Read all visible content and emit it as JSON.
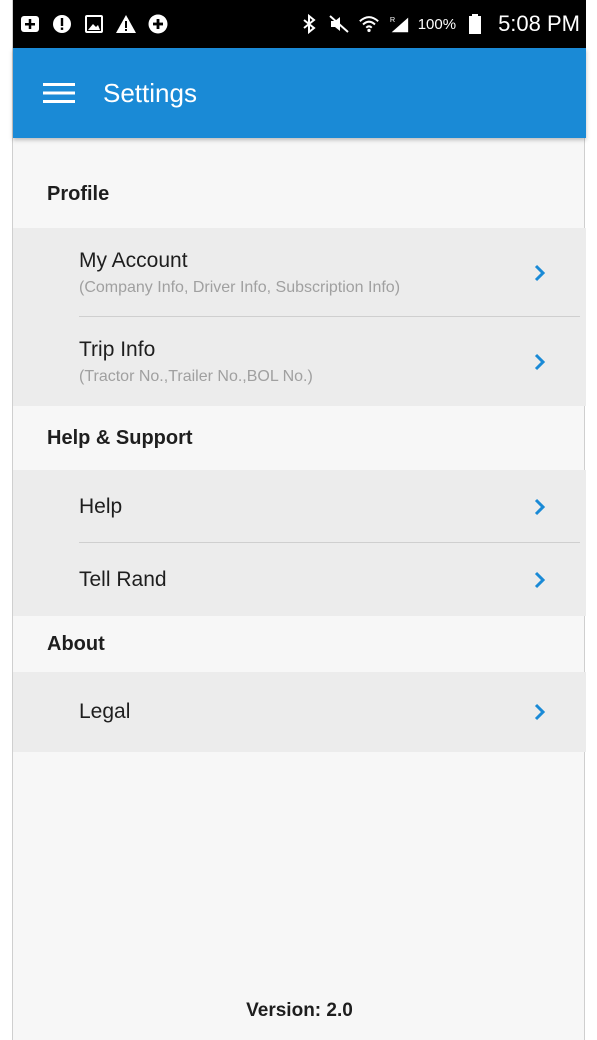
{
  "status_bar": {
    "battery_percent": "100%",
    "time": "5:08 PM",
    "icons": [
      "add-box-icon",
      "alert-circle-icon",
      "image-icon",
      "warning-icon",
      "plus-circle-icon",
      "bluetooth-icon",
      "mute-icon",
      "wifi-icon",
      "signal-roaming-icon",
      "battery-icon"
    ]
  },
  "app_bar": {
    "title": "Settings",
    "background": "#1a8ad6",
    "menu_icon": "hamburger-menu-icon"
  },
  "sections": [
    {
      "header": "Profile",
      "items": [
        {
          "title": "My Account",
          "subtitle": "(Company Info, Driver Info, Subscription Info)"
        },
        {
          "title": "Trip Info",
          "subtitle": "(Tractor No.,Trailer No.,BOL No.)"
        }
      ]
    },
    {
      "header": "Help & Support",
      "items": [
        {
          "title": "Help"
        },
        {
          "title": "Tell Rand"
        }
      ]
    },
    {
      "header": "About",
      "items": [
        {
          "title": "Legal"
        }
      ]
    }
  ],
  "accent_color": "#1a8ad6",
  "footer": {
    "version": "Version: 2.0"
  }
}
